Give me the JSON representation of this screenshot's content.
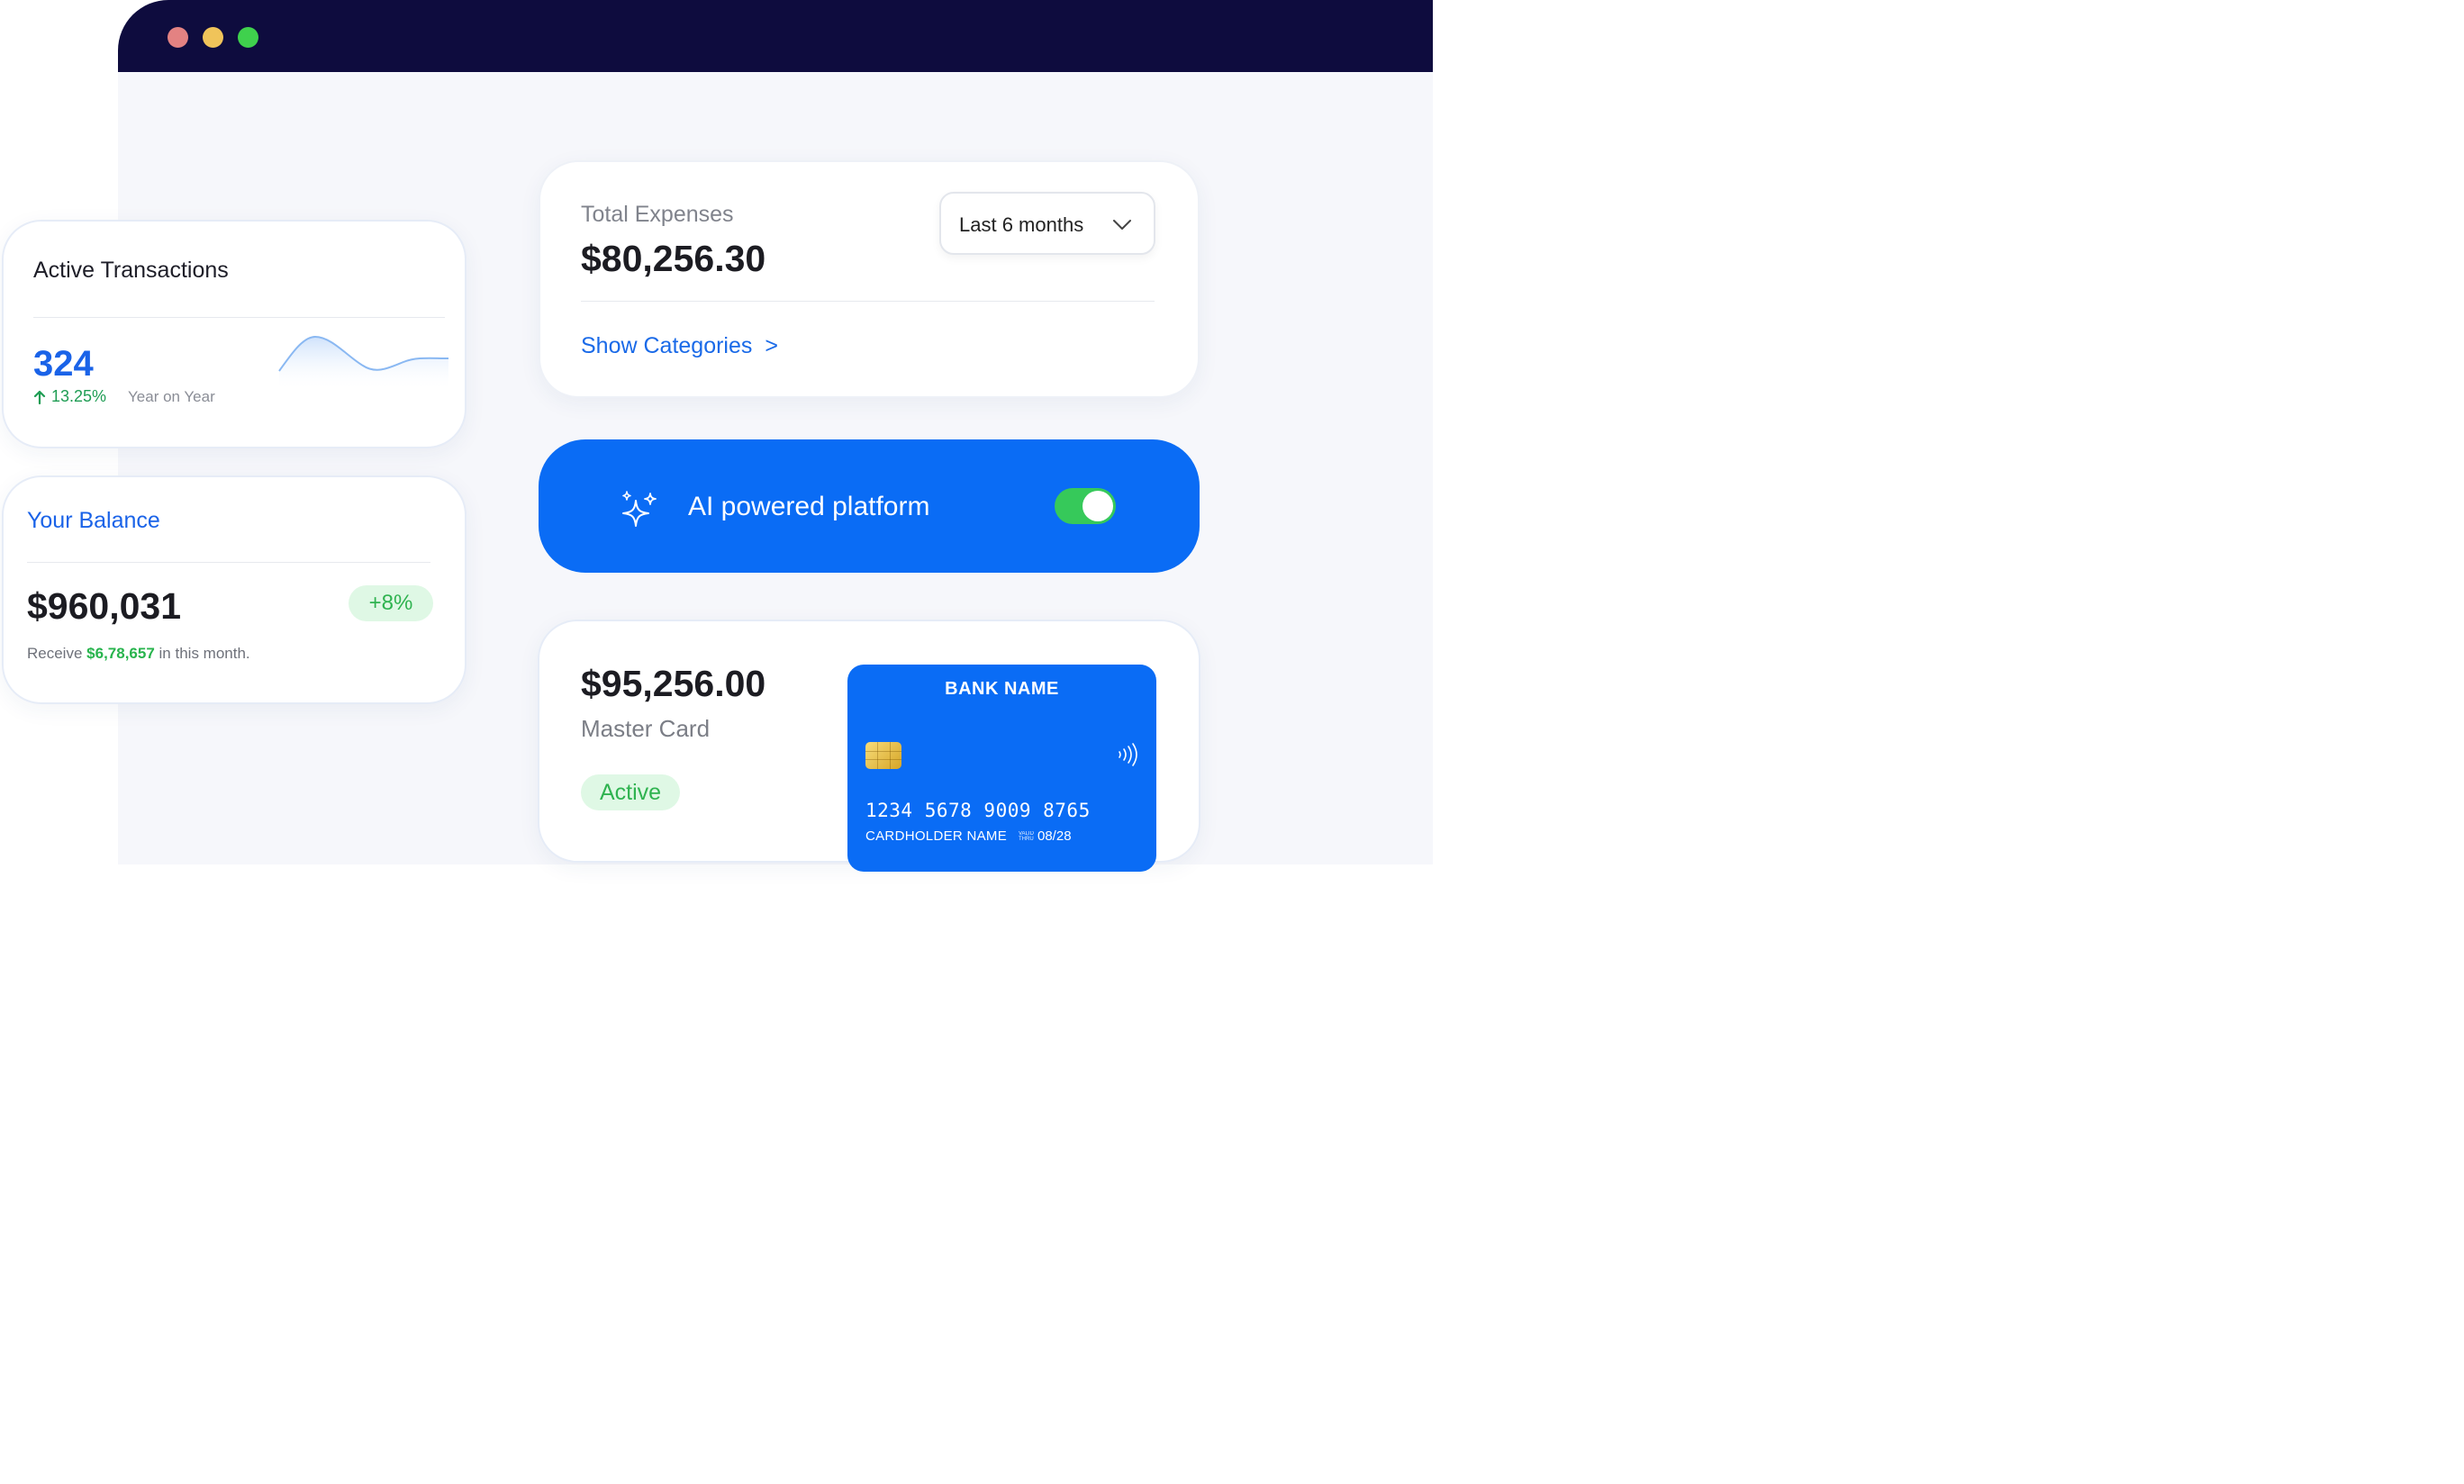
{
  "window": {
    "controls": [
      "close-dot",
      "minimize-dot",
      "maximize-dot"
    ]
  },
  "active_transactions": {
    "title": "Active Transactions",
    "count": "324",
    "growth": "13.25%",
    "period": "Year on Year",
    "trend_color": "#1f9d54"
  },
  "balance": {
    "title": "Your Balance",
    "amount": "$960,031",
    "change": "+8%",
    "note_prefix": "Receive",
    "note_amount": "$6,78,657",
    "note_suffix": "in this month."
  },
  "expenses": {
    "label": "Total Expenses",
    "amount": "$80,256.30",
    "range": "Last 6 months",
    "link": "Show Categories",
    "link_arrow": ">"
  },
  "ai_banner": {
    "text": "AI powered platform",
    "toggle_on": true,
    "background": "#0a6cf5"
  },
  "card_summary": {
    "amount": "$95,256.00",
    "type": "Master Card",
    "status": "Active"
  },
  "credit_card": {
    "bank": "BANK NAME",
    "number": "1234  5678  9009  8765",
    "holder": "CARDHOLDER NAME",
    "valid_label_1": "VALID",
    "valid_label_2": "THRU",
    "expiry": "08/28"
  }
}
